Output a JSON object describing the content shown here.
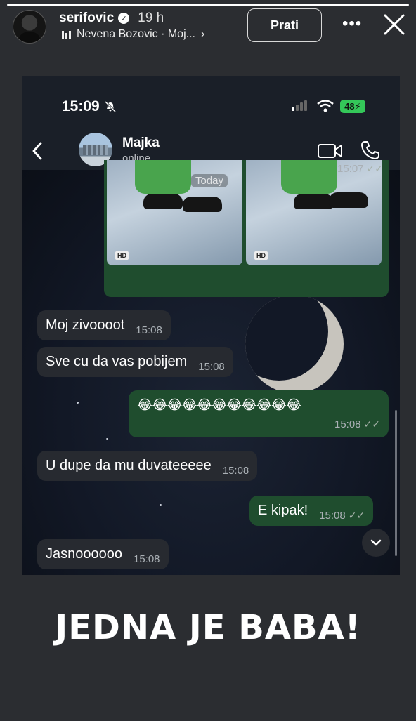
{
  "story": {
    "progress": 1.0,
    "username": "serifovic",
    "time": "19 h",
    "music": "Nevena Bozovic · Moj...",
    "follow_label": "Prati",
    "caption": "JEDNA JE BABA!"
  },
  "phone": {
    "clock": "15:09",
    "battery": "48",
    "chat": {
      "contact_name": "Majka",
      "contact_status": "online",
      "today_label": "Today",
      "media_time": "15:07",
      "hd_label": "HD",
      "messages": [
        {
          "text": "Moj zivoooot",
          "time": "15:08",
          "dir": "in"
        },
        {
          "text": "Sve cu da vas pobijem",
          "time": "15:08",
          "dir": "in"
        },
        {
          "text": "😂😂😂😂😂😂😂😂😂😂😂",
          "time": "15:08",
          "dir": "out"
        },
        {
          "text": "U dupe da mu duvateeeee",
          "time": "15:08",
          "dir": "in"
        },
        {
          "text": "E kipak!",
          "time": "15:08",
          "dir": "out"
        },
        {
          "text": "Jasnoooooo",
          "time": "15:08",
          "dir": "in"
        }
      ]
    }
  },
  "colors": {
    "outgoing_bubble": "#1f4d2e",
    "incoming_bubble": "#272a30",
    "battery": "#34c759"
  }
}
